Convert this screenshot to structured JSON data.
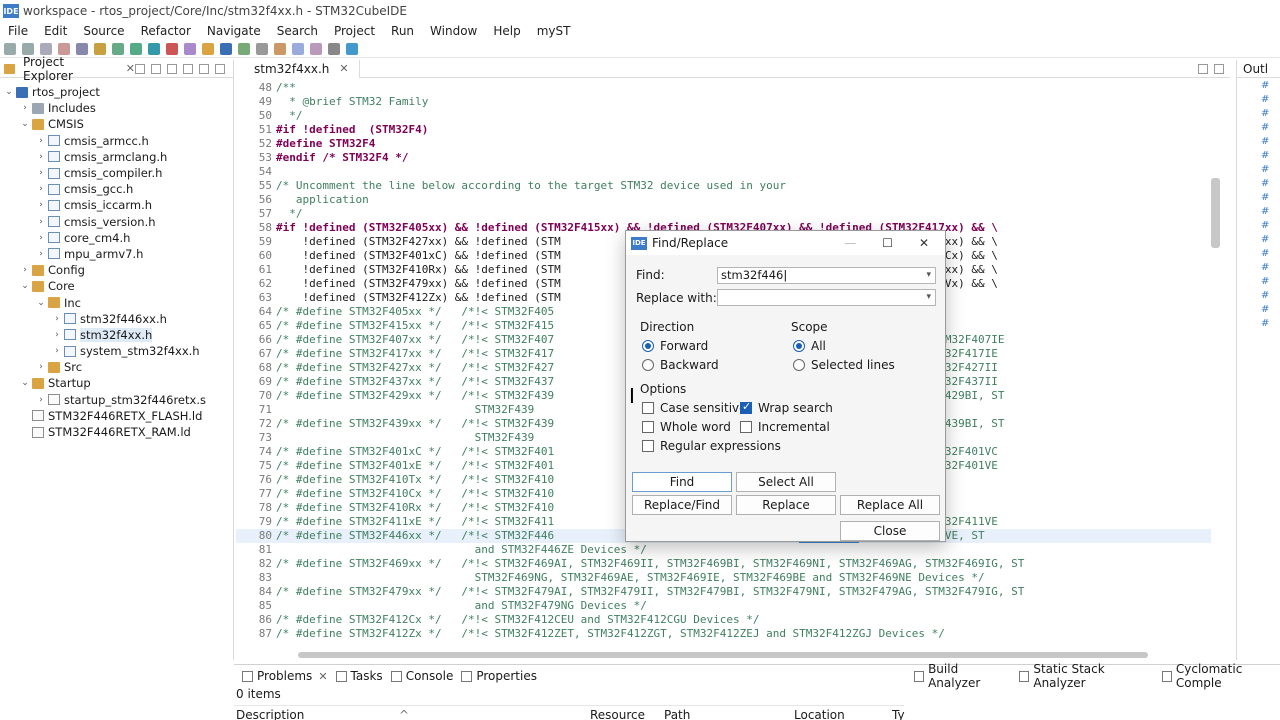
{
  "window": {
    "title": "workspace - rtos_project/Core/Inc/stm32f4xx.h - STM32CubeIDE",
    "logo": "IDE"
  },
  "menu": [
    "File",
    "Edit",
    "Source",
    "Refactor",
    "Navigate",
    "Search",
    "Project",
    "Run",
    "Window",
    "Help",
    "myST"
  ],
  "project_explorer": {
    "tab": "Project Explorer",
    "tree": [
      {
        "label": "rtos_project",
        "depth": 0,
        "expand": "v",
        "icon": "proj"
      },
      {
        "label": "Includes",
        "depth": 1,
        "expand": ">",
        "icon": "incl"
      },
      {
        "label": "CMSIS",
        "depth": 1,
        "expand": "v",
        "icon": "folder"
      },
      {
        "label": "cmsis_armcc.h",
        "depth": 2,
        "expand": ">",
        "icon": "file-h"
      },
      {
        "label": "cmsis_armclang.h",
        "depth": 2,
        "expand": ">",
        "icon": "file-h"
      },
      {
        "label": "cmsis_compiler.h",
        "depth": 2,
        "expand": ">",
        "icon": "file-h"
      },
      {
        "label": "cmsis_gcc.h",
        "depth": 2,
        "expand": ">",
        "icon": "file-h"
      },
      {
        "label": "cmsis_iccarm.h",
        "depth": 2,
        "expand": ">",
        "icon": "file-h"
      },
      {
        "label": "cmsis_version.h",
        "depth": 2,
        "expand": ">",
        "icon": "file-h"
      },
      {
        "label": "core_cm4.h",
        "depth": 2,
        "expand": ">",
        "icon": "file-h"
      },
      {
        "label": "mpu_armv7.h",
        "depth": 2,
        "expand": ">",
        "icon": "file-h"
      },
      {
        "label": "Config",
        "depth": 1,
        "expand": ">",
        "icon": "folder"
      },
      {
        "label": "Core",
        "depth": 1,
        "expand": "v",
        "icon": "folder"
      },
      {
        "label": "Inc",
        "depth": 2,
        "expand": "v",
        "icon": "folder"
      },
      {
        "label": "stm32f446xx.h",
        "depth": 3,
        "expand": ">",
        "icon": "file-h"
      },
      {
        "label": "stm32f4xx.h",
        "depth": 3,
        "expand": ">",
        "icon": "file-h",
        "selected": true
      },
      {
        "label": "system_stm32f4xx.h",
        "depth": 3,
        "expand": ">",
        "icon": "file-h"
      },
      {
        "label": "Src",
        "depth": 2,
        "expand": ">",
        "icon": "folder"
      },
      {
        "label": "Startup",
        "depth": 1,
        "expand": "v",
        "icon": "folder"
      },
      {
        "label": "startup_stm32f446retx.s",
        "depth": 2,
        "expand": ">",
        "icon": "file-s"
      },
      {
        "label": "STM32F446RETX_FLASH.ld",
        "depth": 1,
        "expand": "",
        "icon": "file-ld"
      },
      {
        "label": "STM32F446RETX_RAM.ld",
        "depth": 1,
        "expand": "",
        "icon": "file-ld"
      }
    ]
  },
  "editor": {
    "tab": "stm32f4xx.h",
    "lines": [
      {
        "n": "48",
        "t": "/**",
        "c": "cmt"
      },
      {
        "n": "49",
        "t": "  * @brief STM32 Family",
        "c": "cmt"
      },
      {
        "n": "50",
        "t": "  */",
        "c": "cmt"
      },
      {
        "n": "51",
        "t": "#if !defined  (STM32F4)",
        "c": "kw"
      },
      {
        "n": "52",
        "t": "#define STM32F4",
        "c": "kw"
      },
      {
        "n": "53",
        "t": "#endif /* STM32F4 */",
        "c": "kw"
      },
      {
        "n": "54",
        "t": "",
        "c": ""
      },
      {
        "n": "55",
        "t": "/* Uncomment the line below according to the target STM32 device used in your",
        "c": "cmt"
      },
      {
        "n": "56",
        "t": "   application",
        "c": "cmt"
      },
      {
        "n": "57",
        "t": "  */",
        "c": "cmt"
      },
      {
        "n": "58",
        "t": "#if !defined (STM32F405xx) && !defined (STM32F415xx) && !defined (STM32F407xx) && !defined (STM32F417xx) && \\",
        "c": "kw"
      },
      {
        "n": "59",
        "t": "    !defined (STM32F427xx) && !defined (STM                                       !defined (STM32F439xx) && \\",
        "c": ""
      },
      {
        "n": "60",
        "t": "    !defined (STM32F401xC) && !defined (STM                                       !defined (STM32F410Cx) && \\",
        "c": ""
      },
      {
        "n": "61",
        "t": "    !defined (STM32F410Rx) && !defined (STM                                       !defined (STM32F469xx) && \\",
        "c": ""
      },
      {
        "n": "62",
        "t": "    !defined (STM32F479xx) && !defined (STM                                       !defined (STM32F412Vx) && \\",
        "c": ""
      },
      {
        "n": "63",
        "t": "    !defined (STM32F412Zx) && !defined (STM",
        "c": ""
      },
      {
        "n": "64",
        "t": "/* #define STM32F405xx */   /*!< STM32F405                                      */",
        "c": "cmt"
      },
      {
        "n": "65",
        "t": "/* #define STM32F415xx */   /*!< STM32F415                                      */",
        "c": "cmt"
      },
      {
        "n": "66",
        "t": "/* #define STM32F407xx */   /*!< STM32F407                                     E, STM32F407IG  and STM32F407IE",
        "c": "cmt"
      },
      {
        "n": "67",
        "t": "/* #define STM32F417xx */   /*!< STM32F417                                     E, STM32F417IG and STM32F417IE",
        "c": "cmt"
      },
      {
        "n": "68",
        "t": "/* #define STM32F427xx */   /*!< STM32F427                                     I, STM32F427IG and STM32F427II",
        "c": "cmt"
      },
      {
        "n": "69",
        "t": "/* #define STM32F437xx */   /*!< STM32F437                                     I, STM32F437IG and STM32F437II",
        "c": "cmt"
      },
      {
        "n": "70",
        "t": "/* #define STM32F429xx */   /*!< STM32F439                                     I, STM32F429BG, STM32F429BI, ST",
        "c": "cmt"
      },
      {
        "n": "71",
        "t": "                              STM32F439                                      */",
        "c": "cmt"
      },
      {
        "n": "72",
        "t": "/* #define STM32F439xx */   /*!< STM32F439                                     I, STM32F439BG, STM32F439BI, ST",
        "c": "cmt"
      },
      {
        "n": "73",
        "t": "                              STM32F439",
        "c": "cmt"
      },
      {
        "n": "74",
        "t": "/* #define STM32F401xC */   /*!< STM32F401                                     C, STM32F401VB and STM32F401VC",
        "c": "cmt"
      },
      {
        "n": "75",
        "t": "/* #define STM32F401xE */   /*!< STM32F401                                     E, STM32F401RE and STM32F401VE",
        "c": "cmt"
      },
      {
        "n": "76",
        "t": "/* #define STM32F410Tx */   /*!< STM32F410",
        "c": "cmt"
      },
      {
        "n": "77",
        "t": "/* #define STM32F410Cx */   /*!< STM32F410",
        "c": "cmt"
      },
      {
        "n": "78",
        "t": "/* #define STM32F410Rx */   /*!< STM32F410",
        "c": "cmt"
      },
      {
        "n": "79",
        "t": "/* #define STM32F411xE */   /*!< STM32F411                                     E, STM32F411RE and STM32F411VE",
        "c": "cmt"
      },
      {
        "n": "80",
        "t": "/* #define STM32F446xx */   /*!< STM32F446                                     ",
        "c": "cmt",
        "hl": true,
        "sel": "STM32F446",
        "after": "VC, STM32F446VE, ST"
      },
      {
        "n": "81",
        "t": "                              and STM32F446ZE Devices */",
        "c": "cmt"
      },
      {
        "n": "82",
        "t": "/* #define STM32F469xx */   /*!< STM32F469AI, STM32F469II, STM32F469BI, STM32F469NI, STM32F469AG, STM32F469IG, ST",
        "c": "cmt"
      },
      {
        "n": "83",
        "t": "                              STM32F469NG, STM32F469AE, STM32F469IE, STM32F469BE and STM32F469NE Devices */",
        "c": "cmt"
      },
      {
        "n": "84",
        "t": "/* #define STM32F479xx */   /*!< STM32F479AI, STM32F479II, STM32F479BI, STM32F479NI, STM32F479AG, STM32F479IG, ST",
        "c": "cmt"
      },
      {
        "n": "85",
        "t": "                              and STM32F479NG Devices */",
        "c": "cmt"
      },
      {
        "n": "86",
        "t": "/* #define STM32F412Cx */   /*!< STM32F412CEU and STM32F412CGU Devices */",
        "c": "cmt"
      },
      {
        "n": "87",
        "t": "/* #define STM32F412Zx */   /*!< STM32F412ZET, STM32F412ZGT, STM32F412ZEJ and STM32F412ZGJ Devices */",
        "c": "cmt"
      }
    ]
  },
  "outline": {
    "tab": "Outl"
  },
  "bottom": {
    "tabs": [
      "Problems",
      "Tasks",
      "Console",
      "Properties"
    ],
    "items_count": "0 items",
    "columns": [
      "Description",
      "Resource",
      "Path",
      "Location",
      "Ty"
    ],
    "build_tabs": [
      "Build Analyzer",
      "Static Stack Analyzer",
      "Cyclomatic Comple"
    ]
  },
  "find_replace": {
    "title": "Find/Replace",
    "find_label": "Find:",
    "find_value": "stm32f446",
    "replace_label": "Replace with:",
    "replace_value": "",
    "direction_label": "Direction",
    "forward": "Forward",
    "backward": "Backward",
    "scope_label": "Scope",
    "all": "All",
    "selected_lines": "Selected lines",
    "options_label": "Options",
    "case_sensitive": "Case sensitive",
    "wrap_search": "Wrap search",
    "whole_word": "Whole word",
    "incremental": "Incremental",
    "regex": "Regular expressions",
    "btn_find": "Find",
    "btn_select_all": "Select All",
    "btn_replace_find": "Replace/Find",
    "btn_replace": "Replace",
    "btn_replace_all": "Replace All",
    "btn_close": "Close"
  },
  "colors": {
    "accent": "#1a5fb4",
    "selection": "#3d8ad6",
    "comment": "#3f7f5f",
    "keyword": "#7f0055"
  }
}
